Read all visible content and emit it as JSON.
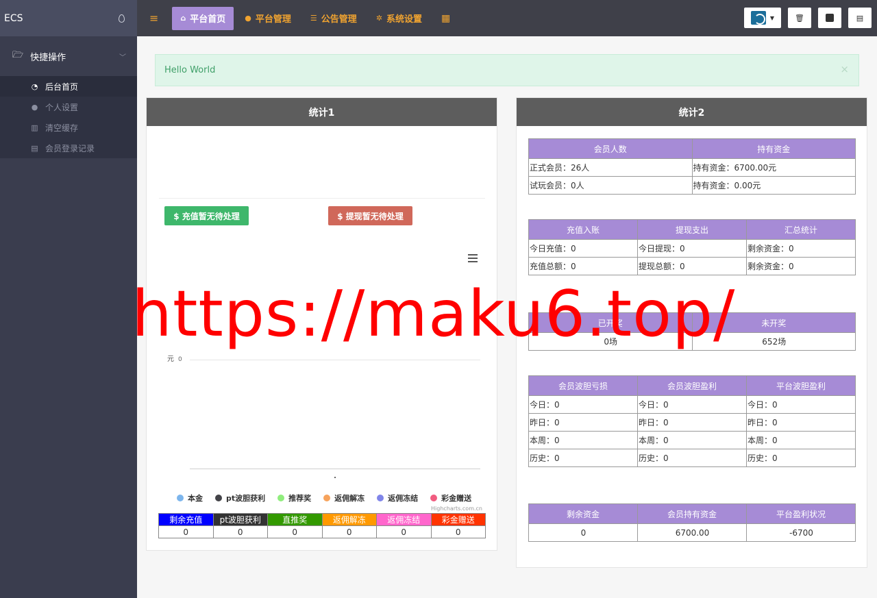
{
  "brand": {
    "title": "ECS"
  },
  "sidebar": {
    "group": {
      "label": "快捷操作"
    },
    "items": [
      {
        "label": "后台首页",
        "icon": "dashboard-icon"
      },
      {
        "label": "个人设置",
        "icon": "user-icon"
      },
      {
        "label": "清空缓存",
        "icon": "trash-icon"
      },
      {
        "label": "会员登录记录",
        "icon": "list-icon"
      }
    ]
  },
  "topnav": {
    "tabs": [
      {
        "label": "平台首页",
        "icon": "home-icon"
      },
      {
        "label": "平台管理",
        "icon": "user-icon"
      },
      {
        "label": "公告管理",
        "icon": "list-icon"
      },
      {
        "label": "系统设置",
        "icon": "gear-icon"
      }
    ]
  },
  "alert": {
    "text": "Hello World",
    "close": "×"
  },
  "panel1": {
    "title": "统计1",
    "recharge_btn": "$ 充值暂无待处理",
    "withdraw_btn": "$ 提现暂无待处理",
    "credit": "Highcharts.com.cn"
  },
  "chart_data": {
    "type": "line",
    "ylabel": "元",
    "yticks": [
      "0"
    ],
    "series": [
      {
        "name": "本金",
        "color": "#7cb5ec",
        "values": []
      },
      {
        "name": "pt波胆获利",
        "color": "#434348",
        "values": []
      },
      {
        "name": "推荐奖",
        "color": "#90ed7d",
        "values": []
      },
      {
        "name": "返佣解冻",
        "color": "#f7a35c",
        "values": []
      },
      {
        "name": "返佣冻结",
        "color": "#8085e9",
        "values": []
      },
      {
        "name": "彩金赠送",
        "color": "#f15c80",
        "values": []
      }
    ]
  },
  "summary": {
    "headers": [
      {
        "label": "剩余充值",
        "color": "#0000ff"
      },
      {
        "label": "pt波胆获利",
        "color": "#333333"
      },
      {
        "label": "直推奖",
        "color": "#339900"
      },
      {
        "label": "返佣解冻",
        "color": "#ff9900"
      },
      {
        "label": "返佣冻结",
        "color": "#ff66cc"
      },
      {
        "label": "彩金赠送",
        "color": "#ff3300"
      }
    ],
    "values": [
      "0",
      "0",
      "0",
      "0",
      "0",
      "0"
    ]
  },
  "panel2": {
    "title": "统计2",
    "members": {
      "headers": [
        "会员人数",
        "持有资金"
      ],
      "rows": [
        [
          "正式会员：26人",
          "持有资金：6700.00元"
        ],
        [
          "试玩会员：0人",
          "持有资金：0.00元"
        ]
      ]
    },
    "finance": {
      "headers": [
        "充值入账",
        "提现支出",
        "汇总统计"
      ],
      "rows": [
        [
          "今日充值：0",
          "今日提现：0",
          "剩余资金：0"
        ],
        [
          "充值总额：0",
          "提现总额：0",
          "剩余资金：0"
        ]
      ]
    },
    "games": {
      "headers": [
        "已开奖",
        "未开奖"
      ],
      "rows": [
        [
          "0场",
          "652场"
        ]
      ]
    },
    "profit": {
      "headers": [
        "会员波胆亏损",
        "会员波胆盈利",
        "平台波胆盈利"
      ],
      "rows": [
        [
          "今日：0",
          "今日：0",
          "今日：0"
        ],
        [
          "昨日：0",
          "昨日：0",
          "昨日：0"
        ],
        [
          "本周：0",
          "本周：0",
          "本周：0"
        ],
        [
          "历史：0",
          "历史：0",
          "历史：0"
        ]
      ]
    },
    "totals": {
      "headers": [
        "剩余资金",
        "会员持有资金",
        "平台盈利状况"
      ],
      "rows": [
        [
          "0",
          "6700.00",
          "-6700"
        ]
      ]
    }
  },
  "watermark": "https://maku6.top/"
}
